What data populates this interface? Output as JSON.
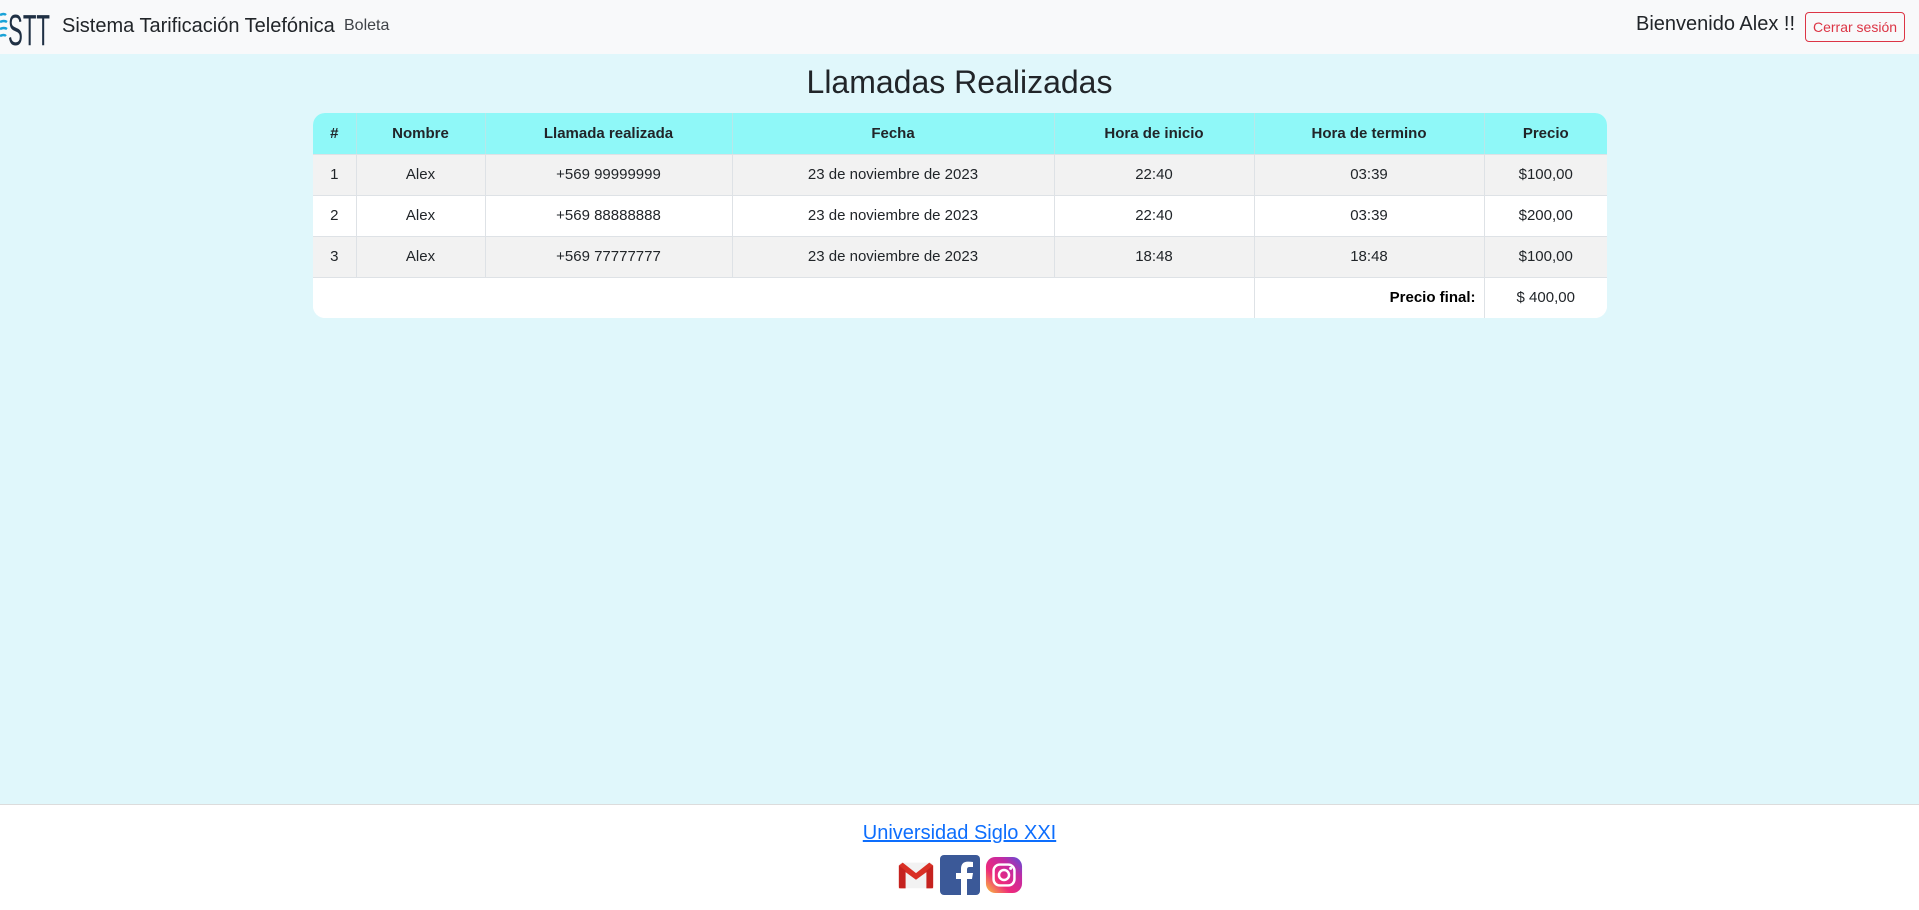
{
  "navbar": {
    "logo_text": "STT",
    "brand": "Sistema Tarificación Telefónica",
    "nav_link": "Boleta",
    "welcome": "Bienvenido Alex !!",
    "logout_label": "Cerrar sesión"
  },
  "main": {
    "title": "Llamadas Realizadas",
    "columns": [
      "#",
      "Nombre",
      "Llamada realizada",
      "Fecha",
      "Hora de inicio",
      "Hora de termino",
      "Precio"
    ],
    "rows": [
      {
        "num": "1",
        "nombre": "Alex",
        "llamada": "+569 99999999",
        "fecha": "23 de noviembre de 2023",
        "inicio": "22:40",
        "termino": "03:39",
        "precio": "$100,00"
      },
      {
        "num": "2",
        "nombre": "Alex",
        "llamada": "+569 88888888",
        "fecha": "23 de noviembre de 2023",
        "inicio": "22:40",
        "termino": "03:39",
        "precio": "$200,00"
      },
      {
        "num": "3",
        "nombre": "Alex",
        "llamada": "+569 77777777",
        "fecha": "23 de noviembre de 2023",
        "inicio": "18:48",
        "termino": "18:48",
        "precio": "$100,00"
      }
    ],
    "total_label": "Precio final:",
    "total_value": "$ 400,00"
  },
  "footer": {
    "link": "Universidad Siglo XXI",
    "icons": [
      "gmail-icon",
      "facebook-icon",
      "instagram-icon"
    ]
  },
  "colors": {
    "page_bg": "#e0f7fb",
    "table_header": "#8ff8f8",
    "danger": "#dc3545",
    "link": "#0d6efd"
  }
}
